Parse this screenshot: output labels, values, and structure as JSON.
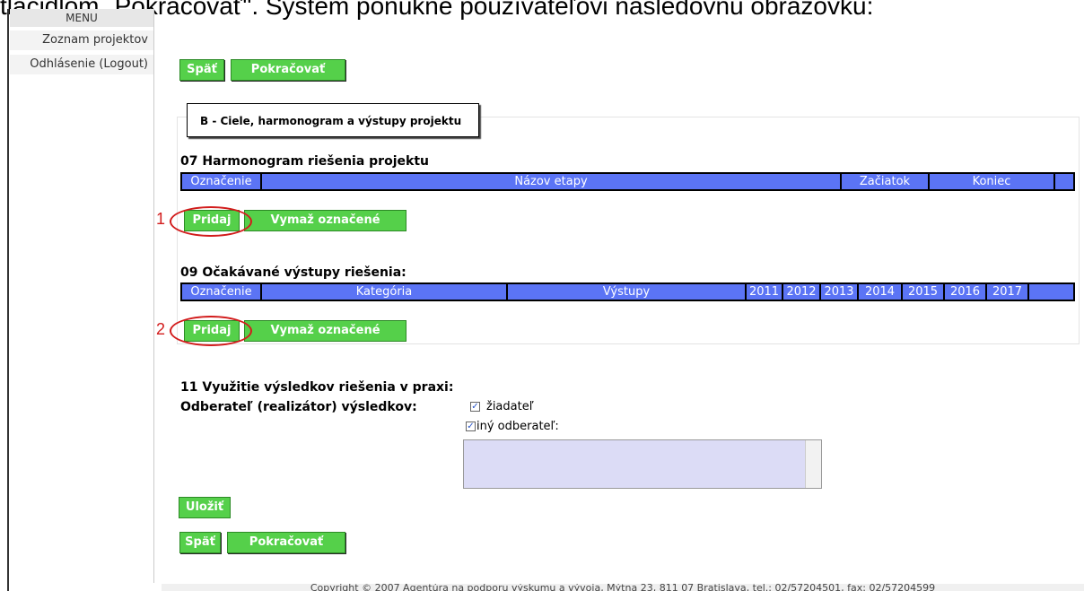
{
  "caption": "tlačidlom „Pokračovať\". Systém ponúkne používateľovi nasledovnú obrazovku:",
  "menu": {
    "header": "MENU",
    "items": [
      "Zoznam projektov",
      "Odhlásenie (Logout)"
    ]
  },
  "nav": {
    "back": "Späť",
    "continue": "Pokračovať"
  },
  "section_title": "B - Ciele, harmonogram a výstupy projektu",
  "schedule": {
    "title": "07 Harmonogram riešenia projektu",
    "columns": [
      "Označenie",
      "Názov etapy",
      "Začiatok",
      "Koniec",
      ""
    ],
    "add": "Pridaj",
    "delete": "Vymaž označené"
  },
  "outputs": {
    "title": "09 Očakávané výstupy riešenia:",
    "columns": [
      "Označenie",
      "Kategória",
      "Výstupy",
      "2011",
      "2012",
      "2013",
      "2014",
      "2015",
      "2016",
      "2017",
      ""
    ],
    "add": "Pridaj",
    "delete": "Vymaž označené"
  },
  "annotations": [
    "1",
    "2"
  ],
  "usage": {
    "title": "11 Využitie výsledkov riešenia v praxi:",
    "recipient_label": "Odberateľ (realizátor) výsledkov:",
    "option1": "žiadateľ",
    "option2": "iný odberateľ:",
    "option1_checked": true,
    "option2_checked": true,
    "text_value": ""
  },
  "save": "Uložiť",
  "footer": "Copyright © 2007 Agentúra na podporu výskumu a vývoja, Mýtna 23, 811 07 Bratislava, tel.: 02/57204501, fax: 02/57204599"
}
